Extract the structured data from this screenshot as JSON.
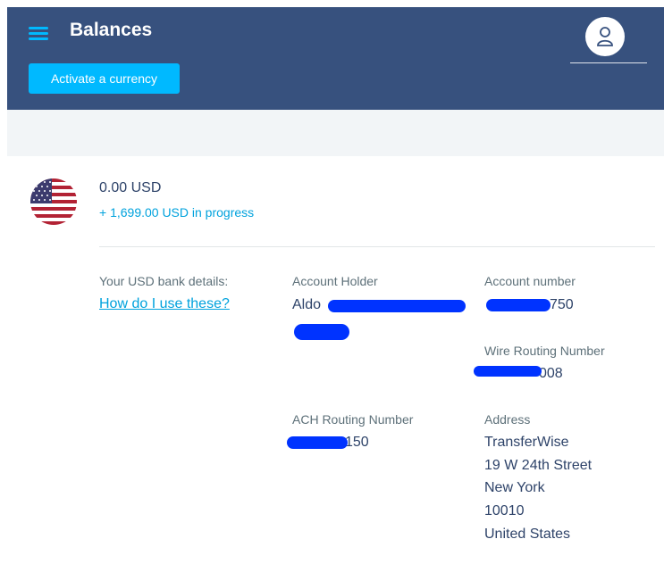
{
  "header": {
    "title": "Balances",
    "activate_button_label": "Activate a currency"
  },
  "balance": {
    "amount": "0.00 USD",
    "in_progress": "+ 1,699.00 USD in progress",
    "currency_flag": "us-flag"
  },
  "bank_details": {
    "label": "Your USD bank details:",
    "help_link": "How do I use these?",
    "account_holder": {
      "label": "Account Holder",
      "value": "Aldo"
    },
    "account_number": {
      "label": "Account number",
      "value": "750"
    },
    "wire_routing": {
      "label": "Wire Routing Number",
      "value": "008"
    },
    "ach_routing": {
      "label": "ACH Routing Number",
      "value": "150"
    },
    "address": {
      "label": "Address",
      "lines": [
        "TransferWise",
        "19 W 24th Street",
        "New York",
        "10010",
        "United States"
      ]
    }
  },
  "colors": {
    "header_bg": "#37517e",
    "accent": "#00b9ff",
    "link": "#00a2dd",
    "redaction": "#0033ff"
  },
  "icons": [
    "hamburger-menu-icon",
    "user-avatar-icon",
    "us-flag"
  ]
}
